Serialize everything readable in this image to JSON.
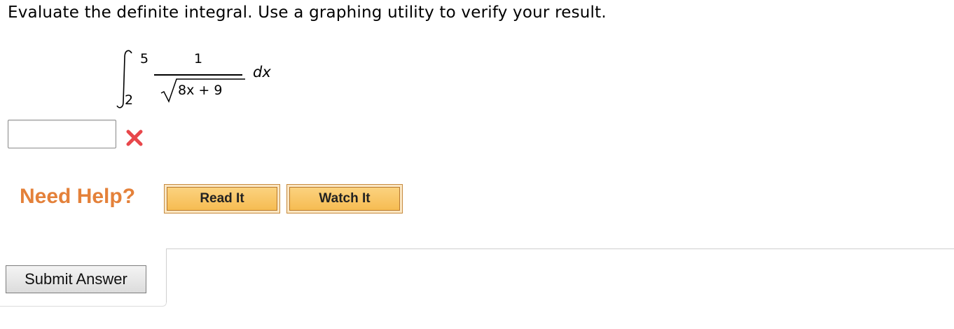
{
  "question": {
    "text": "Evaluate the definite integral. Use a graphing utility to verify your result."
  },
  "integral": {
    "upper_limit": "5",
    "lower_limit": "2",
    "numerator": "1",
    "radicand": "8x + 9",
    "differential": "dx"
  },
  "answer": {
    "value": "",
    "status": "incorrect",
    "status_icon": "x-mark-icon",
    "status_color": "#e8474b"
  },
  "help": {
    "label": "Need Help?",
    "label_color": "#e4813a",
    "read_it": "Read It",
    "watch_it": "Watch It",
    "button_color": "#f6bc52"
  },
  "submit": {
    "label": "Submit Answer"
  }
}
